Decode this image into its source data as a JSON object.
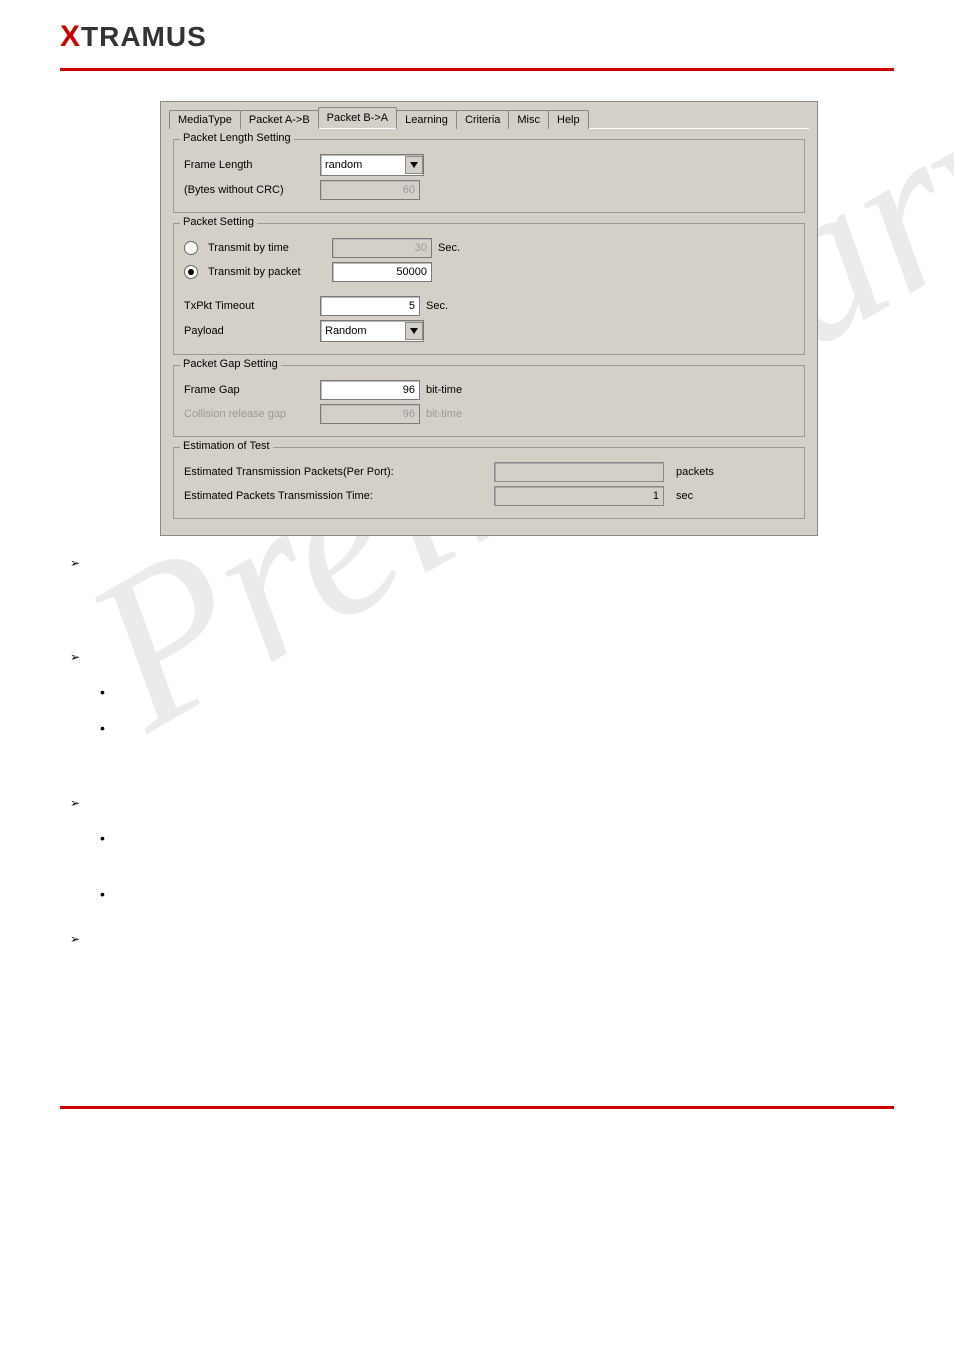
{
  "logo": {
    "letter": "X",
    "rest": "TRAMUS"
  },
  "tabs": [
    {
      "label": "MediaType"
    },
    {
      "label": "Packet A->B"
    },
    {
      "label": "Packet B->A",
      "active": true
    },
    {
      "label": "Learning"
    },
    {
      "label": "Criteria"
    },
    {
      "label": "Misc"
    },
    {
      "label": "Help"
    }
  ],
  "packet_length": {
    "title": "Packet Length Setting",
    "frame_length_label": "Frame Length",
    "frame_length_value": "random",
    "bytes_label": "(Bytes without CRC)",
    "bytes_value": "60"
  },
  "packet_setting": {
    "title": "Packet Setting",
    "by_time_label": "Transmit by time",
    "by_time_value": "30",
    "by_time_unit": "Sec.",
    "by_packet_label": "Transmit by packet",
    "by_packet_value": "50000",
    "txpkt_label": "TxPkt Timeout",
    "txpkt_value": "5",
    "txpkt_unit": "Sec.",
    "payload_label": "Payload",
    "payload_value": "Random"
  },
  "packet_gap": {
    "title": "Packet Gap Setting",
    "frame_gap_label": "Frame Gap",
    "frame_gap_value": "96",
    "frame_gap_unit": "bit-time",
    "collision_label": "Collision release gap",
    "collision_value": "96",
    "collision_unit": "bit-time"
  },
  "estimation": {
    "title": "Estimation of Test",
    "packets_label": "Estimated Transmission Packets(Per Port):",
    "packets_value": "",
    "packets_unit": "packets",
    "time_label": "Estimated Packets Transmission Time:",
    "time_value": "1",
    "time_unit": "sec"
  },
  "watermark": "Preliminary"
}
